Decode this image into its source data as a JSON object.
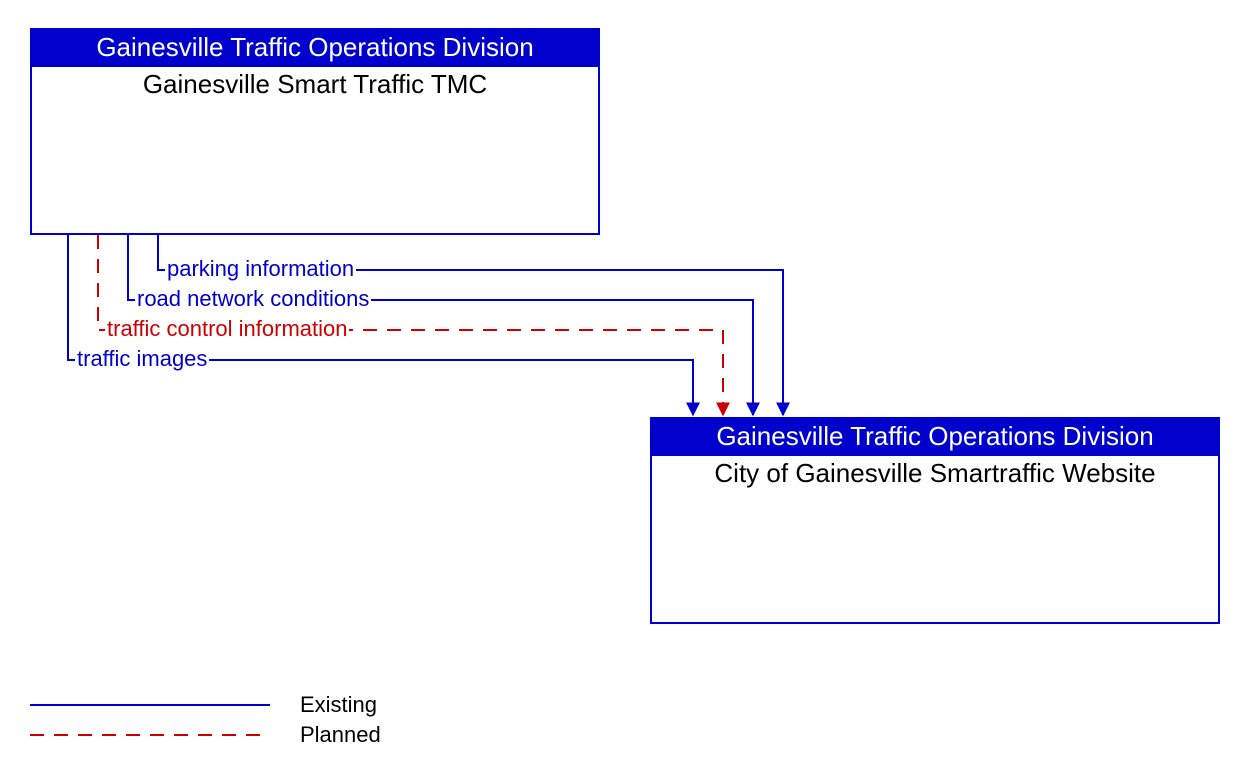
{
  "source_box": {
    "header": "Gainesville Traffic Operations Division",
    "title": "Gainesville Smart Traffic TMC"
  },
  "dest_box": {
    "header": "Gainesville Traffic Operations Division",
    "title": "City of Gainesville Smartraffic Website"
  },
  "flows": [
    {
      "label": "parking information",
      "status": "existing"
    },
    {
      "label": "road network conditions",
      "status": "existing"
    },
    {
      "label": "traffic control information",
      "status": "planned"
    },
    {
      "label": "traffic images",
      "status": "existing"
    }
  ],
  "legend": {
    "existing": "Existing",
    "planned": "Planned"
  },
  "colors": {
    "existing": "#0000cc",
    "planned": "#cc0000"
  }
}
